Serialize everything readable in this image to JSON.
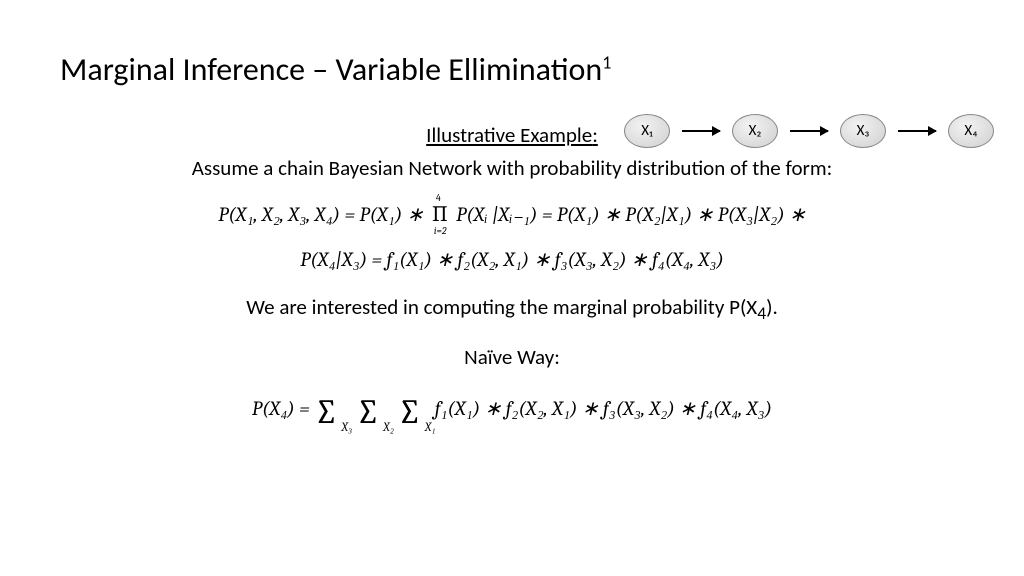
{
  "title_main": "Marginal Inference – Variable Ellimination",
  "title_sup": "1",
  "nodes": [
    "X₁",
    "X₂",
    "X₃",
    "X₄"
  ],
  "heading1": "Illustrative Example",
  "intro": "Assume a chain Bayesian Network with probability distribution of the form:",
  "eq1_a": "P(X₁, X₂, X₃, X₄) = P(X₁) ∗ ",
  "eq1_pi_sub": "i=2",
  "eq1_pi_sup": "4",
  "eq1_b": " P(Xᵢ |Xᵢ₋₁) = P(X₁) ∗ P(X₂|X₁) ∗ P(X₃|X₂) ∗",
  "eq2": "P(X₄|X₃) = f₁(X₁) ∗ f₂(X₂, X₁) ∗ f₃(X₃, X₂) ∗ f₄(X₄, X₃)",
  "interest_a": "We are interested in computing the marginal probability P(X",
  "interest_sub": "4",
  "interest_b": ").",
  "heading2": "Naïve Way:",
  "eq3_pre": "P(X₄) = ",
  "eq3_s1": "X₃",
  "eq3_s2": "X₂",
  "eq3_s3": "X₁",
  "eq3_post": " f₁(X₁) ∗ f₂(X₂, X₁) ∗ f₃(X₃, X₂) ∗ f₄(X₄, X₃)"
}
